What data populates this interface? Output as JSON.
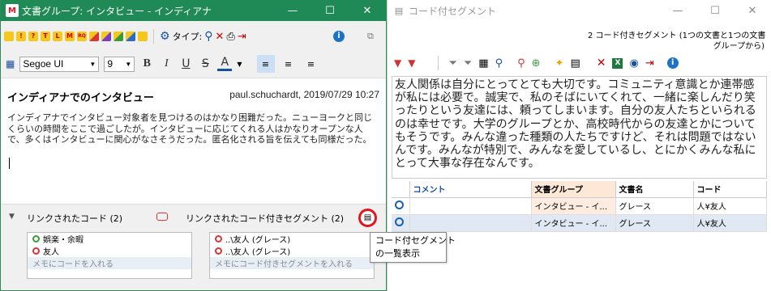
{
  "left": {
    "title": "文書グループ: インタビュー - インディアナ",
    "toolbar": {
      "type_label": "タイプ:"
    },
    "format": {
      "font": "Segoe UI",
      "size": "9"
    },
    "doc": {
      "heading": "インディアナでのインタビュー",
      "meta": "paul.schuchardt, 2019/07/29 10:27",
      "body": "インディアナでインタビュー対象者を見つけるのはかなり困難だった。ニューヨークと同じくらいの時間をここで過ごしたが。インタビューに応じてくれる人はかなりオープンな人で、多くはインタビューに関心がなさそうだった。匿名化される旨を伝えても同様だった。"
    },
    "links": {
      "codes_label": "リンクされたコード (2)",
      "segments_label": "リンクされたコード付きセグメント (2)",
      "codes": [
        "娯楽・余暇",
        "友人"
      ],
      "codes_memo": "メモにコードを入れる",
      "segments": [
        "..\\友人 (グレース)",
        "..\\友人 (グレース)"
      ],
      "segments_memo": "メモにコード付きセグメントを入れる"
    },
    "tooltip": "コード付セグメント\nの一覧表示"
  },
  "right": {
    "title": "コード付セグメント",
    "summary": "2 コード付きセグメント (1つの文書と1つの文書\nグループから)",
    "segment_text": "友人関係は自分にとってとても大切です。コミュニティ意識とか連帯感が私には必要で。誠実で、私のそばにいてくれて、一緒に楽しんだり笑ったりという友達には、頼ってしまいます。自分の友人たちといられるのは幸せです。大学のグループとか、高校時代からの友達とかについてもそうです。みんな違った種類の人たちですけど、それは問題ではないんです。みんなが特別で、みんなを愛しているし、とにかくみんな私にとって大事な存在なんです。",
    "table": {
      "headers": [
        "コメント",
        "文書グループ",
        "文書名",
        "コード"
      ],
      "rows": [
        [
          "",
          "インタビュー - イ...",
          "グレース",
          "人¥友人"
        ],
        [
          "",
          "インタビュー - イ...",
          "グレース",
          "人¥友人"
        ]
      ]
    }
  },
  "colors": {
    "left_title": "#1f8a55",
    "highlight": "#e8141b"
  }
}
